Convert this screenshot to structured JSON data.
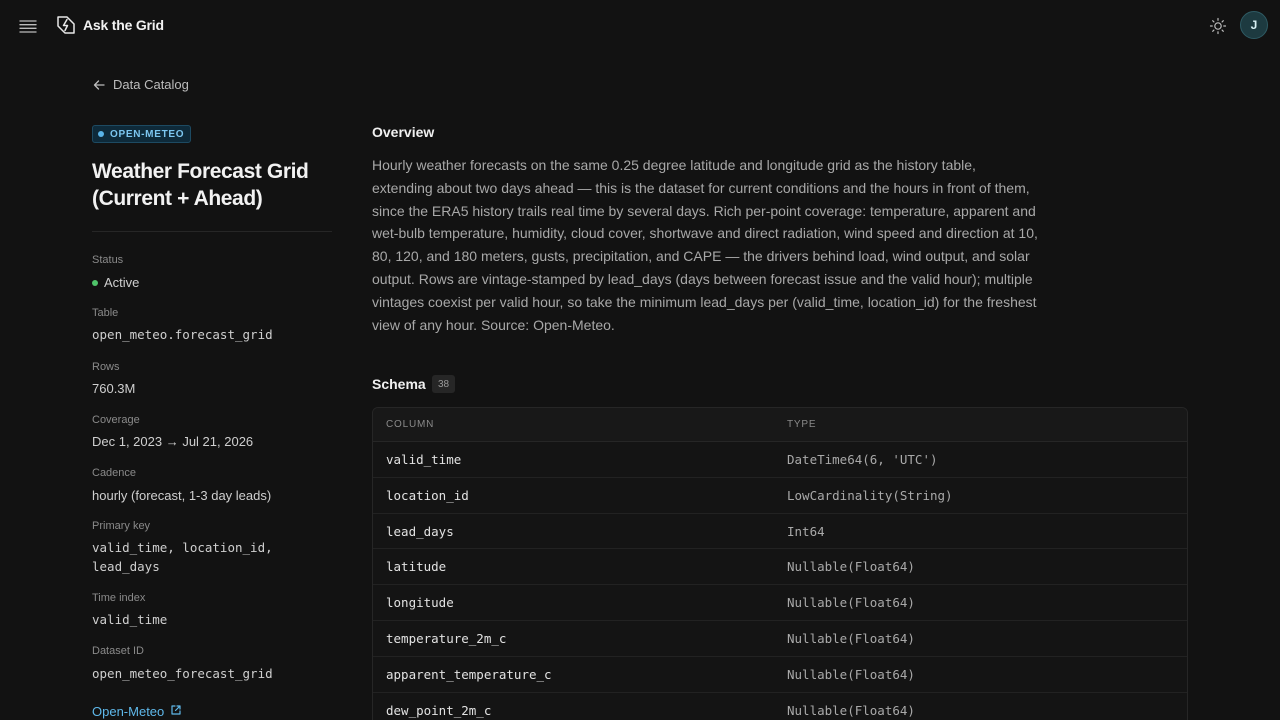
{
  "app": {
    "title": "Ask the Grid",
    "avatar_initial": "J"
  },
  "nav": {
    "back_label": "Data Catalog"
  },
  "dataset": {
    "source_badge": "OPEN-METEO",
    "title": "Weather Forecast Grid (Current + Ahead)",
    "meta": {
      "status_label": "Status",
      "status_value": "Active",
      "table_label": "Table",
      "table_value": "open_meteo.forecast_grid",
      "rows_label": "Rows",
      "rows_value": "760.3M",
      "coverage_label": "Coverage",
      "coverage_value": "Dec 1, 2023 → Jul 21, 2026",
      "cadence_label": "Cadence",
      "cadence_value": "hourly (forecast, 1-3 day leads)",
      "primary_key_label": "Primary key",
      "primary_key_value": "valid_time, location_id, lead_days",
      "time_index_label": "Time index",
      "time_index_value": "valid_time",
      "dataset_id_label": "Dataset ID",
      "dataset_id_value": "open_meteo_forecast_grid"
    },
    "source_link": "Open-Meteo"
  },
  "overview": {
    "title": "Overview",
    "text": "Hourly weather forecasts on the same 0.25 degree latitude and longitude grid as the history table, extending about two days ahead — this is the dataset for current conditions and the hours in front of them, since the ERA5 history trails real time by several days. Rich per-point coverage: temperature, apparent and wet-bulb temperature, humidity, cloud cover, shortwave and direct radiation, wind speed and direction at 10, 80, 120, and 180 meters, gusts, precipitation, and CAPE — the drivers behind load, wind output, and solar output. Rows are vintage-stamped by lead_days (days between forecast issue and the valid hour); multiple vintages coexist per valid hour, so take the minimum lead_days per (valid_time, location_id) for the freshest view of any hour. Source: Open-Meteo."
  },
  "schema": {
    "title": "Schema",
    "count": "38",
    "headers": {
      "column": "COLUMN",
      "type": "TYPE"
    },
    "rows": [
      {
        "name": "valid_time",
        "type": "DateTime64(6, 'UTC')"
      },
      {
        "name": "location_id",
        "type": "LowCardinality(String)"
      },
      {
        "name": "lead_days",
        "type": "Int64"
      },
      {
        "name": "latitude",
        "type": "Nullable(Float64)"
      },
      {
        "name": "longitude",
        "type": "Nullable(Float64)"
      },
      {
        "name": "temperature_2m_c",
        "type": "Nullable(Float64)"
      },
      {
        "name": "apparent_temperature_c",
        "type": "Nullable(Float64)"
      },
      {
        "name": "dew_point_2m_c",
        "type": "Nullable(Float64)"
      }
    ]
  },
  "colors": {
    "background": "#121212",
    "accent": "#5fb8ea",
    "status_active": "#4fc46a"
  }
}
